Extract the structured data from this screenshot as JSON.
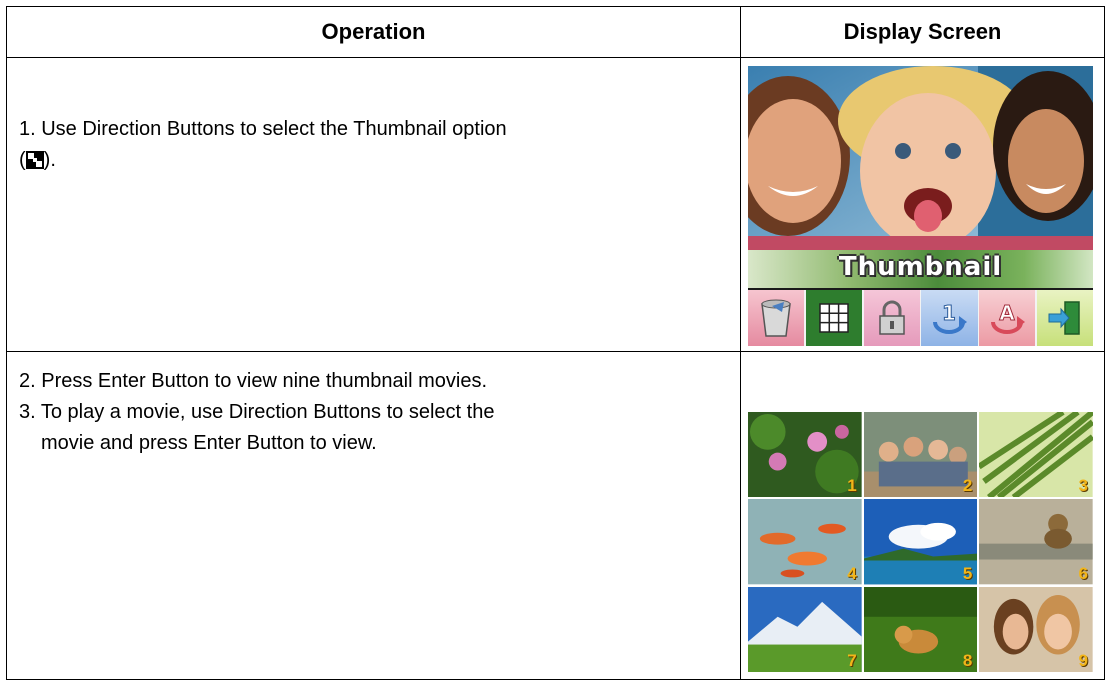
{
  "table": {
    "header_operation": "Operation",
    "header_display": "Display Screen"
  },
  "row1": {
    "step_text": "1. Use Direction Buttons to select the Thumbnail option",
    "open_paren": "(",
    "close_paren": ").",
    "screen": {
      "menu_label": "Thumbnail",
      "icons": [
        "trash-icon",
        "thumbnail-grid-icon",
        "lock-icon",
        "rotate-1-icon",
        "rotate-a-icon",
        "exit-door-icon"
      ],
      "selected_icon": "thumbnail-grid-icon"
    }
  },
  "row2": {
    "step2": "2. Press Enter Button to view nine thumbnail movies.",
    "step3_line1": "3. To play a movie, use Direction Buttons to select the",
    "step3_line2": "movie and press Enter Button to view.",
    "thumbnails": [
      {
        "num": "1",
        "scene": "lotus-flowers"
      },
      {
        "num": "2",
        "scene": "group-of-friends"
      },
      {
        "num": "3",
        "scene": "palm-leaf"
      },
      {
        "num": "4",
        "scene": "koi-fish"
      },
      {
        "num": "5",
        "scene": "blue-sky-island"
      },
      {
        "num": "6",
        "scene": "bird-statue"
      },
      {
        "num": "7",
        "scene": "mountain-landscape"
      },
      {
        "num": "8",
        "scene": "puppy-on-grass"
      },
      {
        "num": "9",
        "scene": "women-on-phone"
      }
    ]
  },
  "colors": {
    "thumb_number": "#f2b519",
    "menu_selected": "#2e7d2e"
  }
}
